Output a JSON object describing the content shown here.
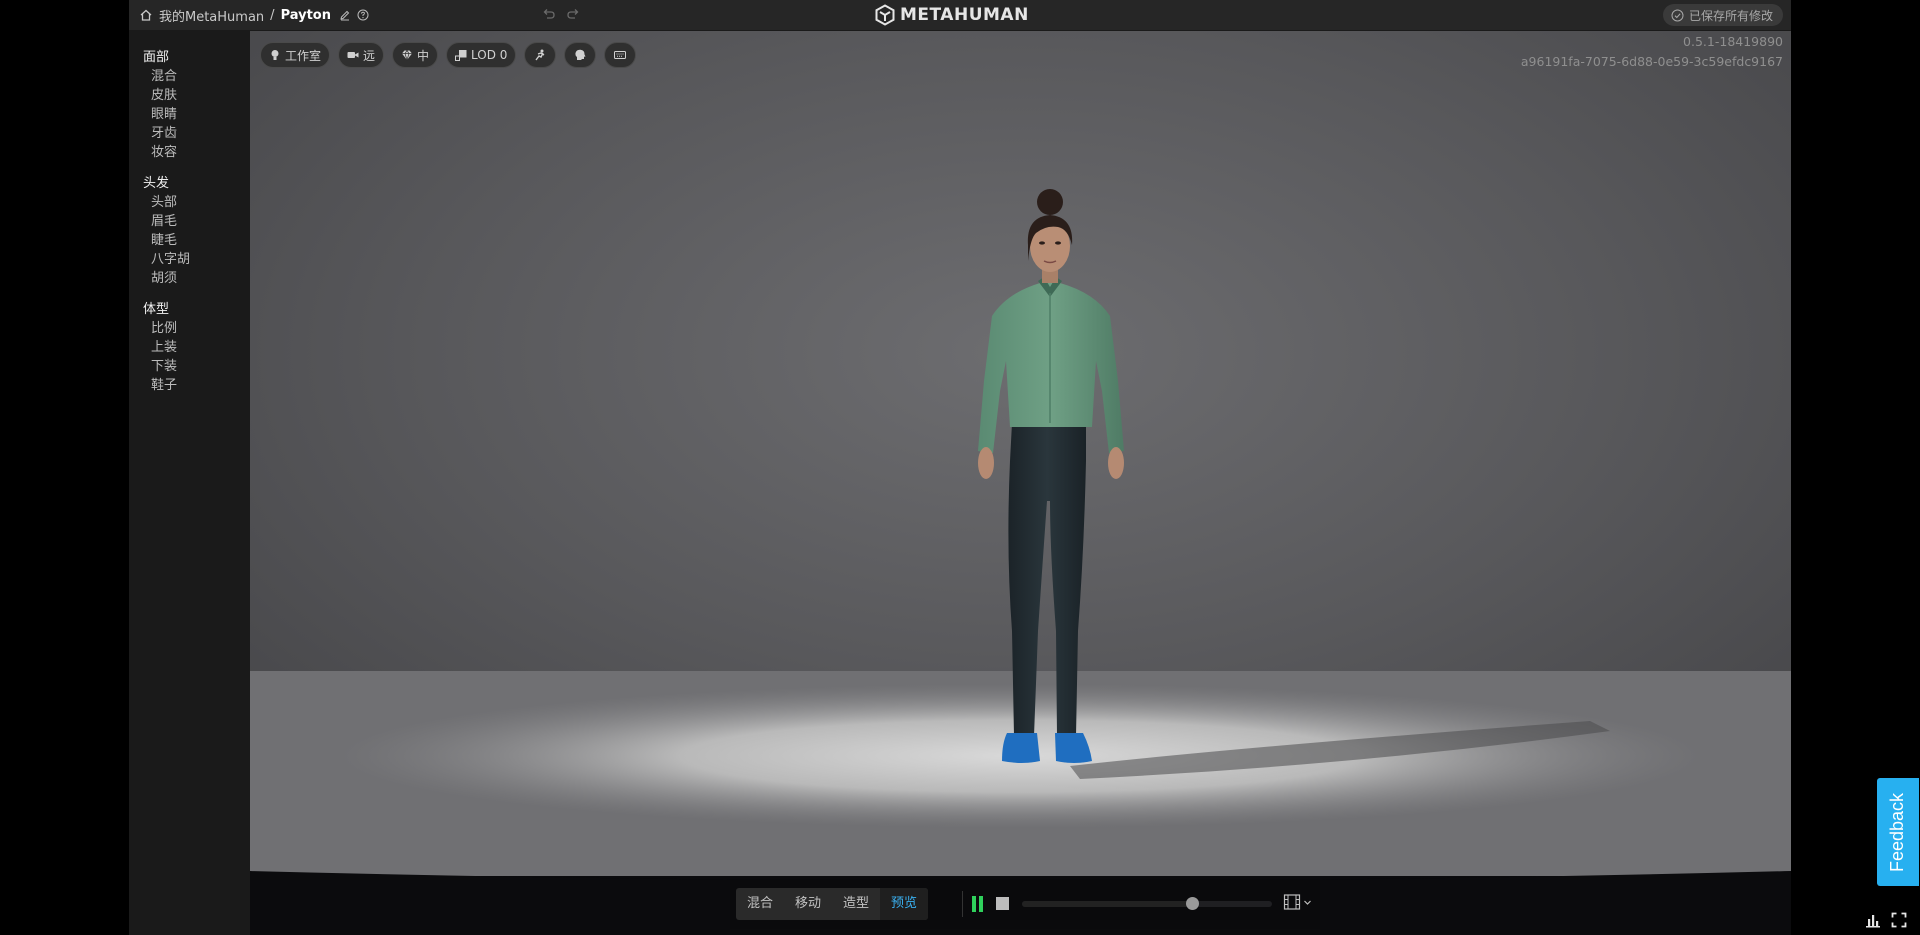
{
  "header": {
    "breadcrumb_root": "我的MetaHuman",
    "breadcrumb_separator": "/",
    "character_name": "Payton",
    "logo_text": "METAHUMAN",
    "save_status": "已保存所有修改"
  },
  "sidebar": {
    "groups": [
      {
        "title": "面部",
        "items": [
          "混合",
          "皮肤",
          "眼睛",
          "牙齿",
          "妆容"
        ]
      },
      {
        "title": "头发",
        "items": [
          "头部",
          "眉毛",
          "睫毛",
          "八字胡",
          "胡须"
        ]
      },
      {
        "title": "体型",
        "items": [
          "比例",
          "上装",
          "下装",
          "鞋子"
        ]
      }
    ]
  },
  "viewport": {
    "toolbar": {
      "lighting_label": "工作室",
      "camera_label": "远",
      "quality_label": "中",
      "lod_label": "LOD 0"
    },
    "version": "0.5.1-18419890",
    "session_id": "a96191fa-7075-6d88-0e59-3c59efdc9167"
  },
  "bottombar": {
    "modes": [
      "混合",
      "移动",
      "造型",
      "预览"
    ],
    "active_mode": "预览",
    "playback_position": 0.68
  },
  "feedback_label": "Feedback",
  "colors": {
    "accent": "#3ab0f0",
    "play_green": "#2fd15c",
    "feedback_bg": "#27b0f0"
  }
}
